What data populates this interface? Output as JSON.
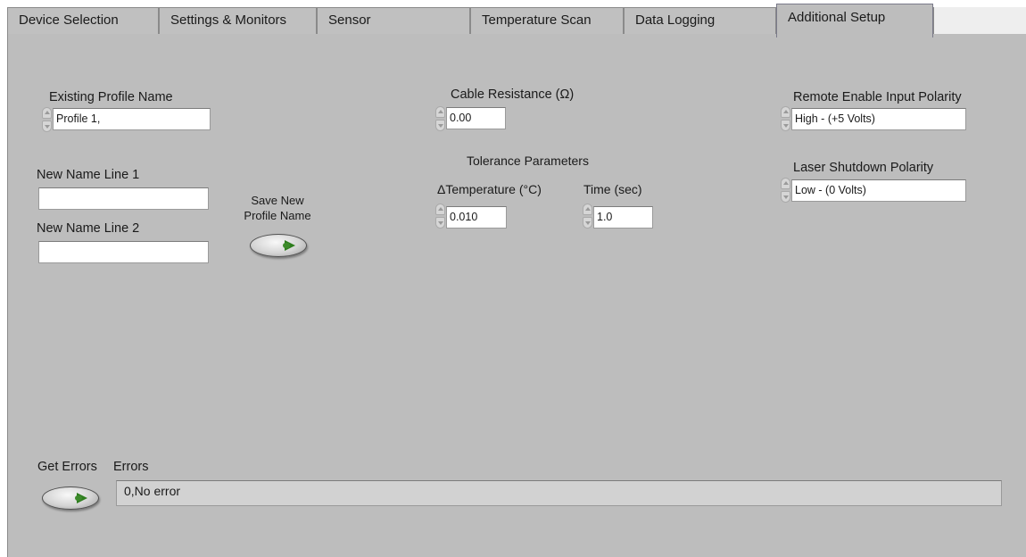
{
  "tabs": [
    {
      "label": "Device Selection"
    },
    {
      "label": "Settings & Monitors"
    },
    {
      "label": "Sensor"
    },
    {
      "label": "Temperature Scan"
    },
    {
      "label": "Data Logging"
    },
    {
      "label": "Additional Setup"
    }
  ],
  "active_tab": "Additional Setup",
  "profile": {
    "existing_label": "Existing Profile Name",
    "existing_value": "Profile 1,",
    "new_line1_label": "New Name Line 1",
    "new_line1_value": "",
    "new_line2_label": "New Name Line 2",
    "new_line2_value": "",
    "save_label_line1": "Save New",
    "save_label_line2": "Profile Name"
  },
  "cable": {
    "label": "Cable Resistance (Ω)",
    "value": "0.00"
  },
  "tolerance": {
    "heading": "Tolerance Parameters",
    "dtemp_label": "ΔTemperature (°C)",
    "dtemp_value": "0.010",
    "time_label": "Time (sec)",
    "time_value": "1.0"
  },
  "polarity": {
    "remote_label": "Remote Enable Input Polarity",
    "remote_value": "High - (+5 Volts)",
    "laser_label": "Laser Shutdown Polarity",
    "laser_value": "Low - (0 Volts)"
  },
  "errors": {
    "get_label": "Get Errors",
    "label": "Errors",
    "value": "0,No error"
  },
  "colors": {
    "panel_bg": "#bdbdbd",
    "led_green": "#2e7d1e"
  }
}
